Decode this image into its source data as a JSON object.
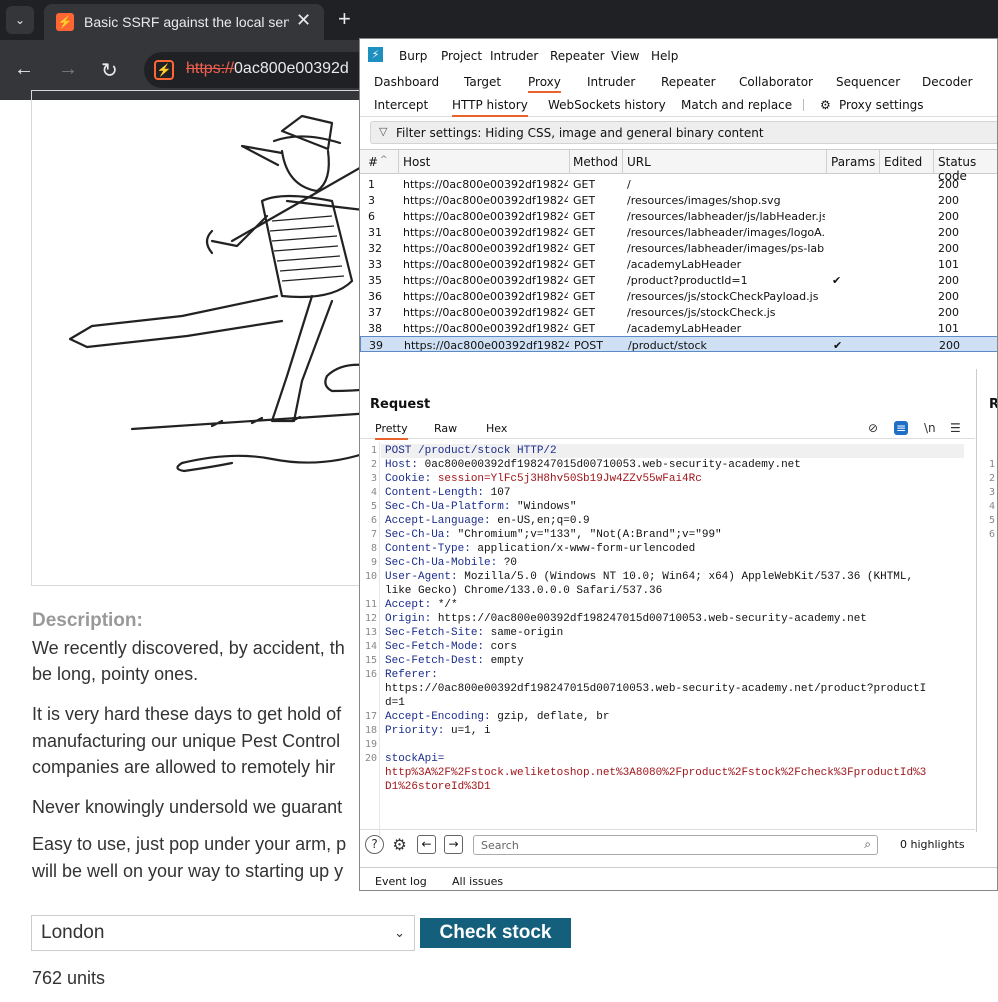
{
  "browser": {
    "tab_title": "Basic SSRF against the local server",
    "url_scheme": "https://",
    "url_rest": "0ac800e00392d"
  },
  "page": {
    "description_label": "Description:",
    "description_lines": [
      "We recently discovered, by accident, th",
      "be long, pointy ones.",
      "It is very hard these days to get hold of",
      "manufacturing our unique Pest Control",
      "companies are allowed to remotely hir",
      "Never knowingly undersold we guarant",
      "Easy to use, just pop under your arm, p",
      "will be well on your way to starting up y"
    ],
    "store_selected": "London",
    "check_stock_label": "Check stock",
    "stock_result": "762 units"
  },
  "burp": {
    "menu": [
      "Burp",
      "Project",
      "Intruder",
      "Repeater",
      "View",
      "Help"
    ],
    "tabs": [
      "Dashboard",
      "Target",
      "Proxy",
      "Intruder",
      "Repeater",
      "Collaborator",
      "Sequencer",
      "Decoder"
    ],
    "active_tab": "Proxy",
    "subtabs": [
      "Intercept",
      "HTTP history",
      "WebSockets history",
      "Match and replace"
    ],
    "proxy_settings": "Proxy settings",
    "filter_text": "Filter settings: Hiding CSS, image and general binary content",
    "columns": [
      "#",
      "Host",
      "Method",
      "URL",
      "Params",
      "Edited",
      "Status code"
    ],
    "rows": [
      {
        "n": "1",
        "host": "https://0ac800e00392df19824...",
        "method": "GET",
        "url": "/",
        "params": "",
        "status": "200"
      },
      {
        "n": "3",
        "host": "https://0ac800e00392df19824...",
        "method": "GET",
        "url": "/resources/images/shop.svg",
        "params": "",
        "status": "200"
      },
      {
        "n": "6",
        "host": "https://0ac800e00392df19824...",
        "method": "GET",
        "url": "/resources/labheader/js/labHeader.js",
        "params": "",
        "status": "200"
      },
      {
        "n": "31",
        "host": "https://0ac800e00392df19824...",
        "method": "GET",
        "url": "/resources/labheader/images/logoA...",
        "params": "",
        "status": "200"
      },
      {
        "n": "32",
        "host": "https://0ac800e00392df19824...",
        "method": "GET",
        "url": "/resources/labheader/images/ps-lab...",
        "params": "",
        "status": "200"
      },
      {
        "n": "33",
        "host": "https://0ac800e00392df19824...",
        "method": "GET",
        "url": "/academyLabHeader",
        "params": "",
        "status": "101"
      },
      {
        "n": "35",
        "host": "https://0ac800e00392df19824...",
        "method": "GET",
        "url": "/product?productId=1",
        "params": "✔",
        "status": "200"
      },
      {
        "n": "36",
        "host": "https://0ac800e00392df19824...",
        "method": "GET",
        "url": "/resources/js/stockCheckPayload.js",
        "params": "",
        "status": "200"
      },
      {
        "n": "37",
        "host": "https://0ac800e00392df19824...",
        "method": "GET",
        "url": "/resources/js/stockCheck.js",
        "params": "",
        "status": "200"
      },
      {
        "n": "38",
        "host": "https://0ac800e00392df19824...",
        "method": "GET",
        "url": "/academyLabHeader",
        "params": "",
        "status": "101"
      },
      {
        "n": "39",
        "host": "https://0ac800e00392df19824...",
        "method": "POST",
        "url": "/product/stock",
        "params": "✔",
        "status": "200"
      }
    ],
    "request": {
      "title": "Request",
      "tabs": [
        "Pretty",
        "Raw",
        "Hex"
      ],
      "newline_label": "\\n",
      "lines": [
        {
          "k": "POST /product/stock HTTP/2",
          "v": ""
        },
        {
          "k": "Host:",
          "v": " 0ac800e00392df198247015d00710053.web-security-academy.net"
        },
        {
          "k": "Cookie:",
          "v": " session=YlFc5j3H8hv50Sb19Jw4ZZv55wFai4Rc"
        },
        {
          "k": "Content-Length:",
          "v": " 107"
        },
        {
          "k": "Sec-Ch-Ua-Platform:",
          "v": " \"Windows\""
        },
        {
          "k": "Accept-Language:",
          "v": " en-US,en;q=0.9"
        },
        {
          "k": "Sec-Ch-Ua:",
          "v": " \"Chromium\";v=\"133\", \"Not(A:Brand\";v=\"99\""
        },
        {
          "k": "Content-Type:",
          "v": " application/x-www-form-urlencoded"
        },
        {
          "k": "Sec-Ch-Ua-Mobile:",
          "v": " ?0"
        },
        {
          "k": "User-Agent:",
          "v": " Mozilla/5.0 (Windows NT 10.0; Win64; x64) AppleWebKit/537.36 (KHTML,"
        },
        {
          "k": "",
          "v": "like Gecko) Chrome/133.0.0.0 Safari/537.36"
        },
        {
          "k": "Accept:",
          "v": " */*"
        },
        {
          "k": "Origin:",
          "v": " https://0ac800e00392df198247015d00710053.web-security-academy.net"
        },
        {
          "k": "Sec-Fetch-Site:",
          "v": " same-origin"
        },
        {
          "k": "Sec-Fetch-Mode:",
          "v": " cors"
        },
        {
          "k": "Sec-Fetch-Dest:",
          "v": " empty"
        },
        {
          "k": "Referer:",
          "v": ""
        },
        {
          "k": "",
          "v": "https://0ac800e00392df198247015d00710053.web-security-academy.net/product?productI"
        },
        {
          "k": "",
          "v": "d=1"
        },
        {
          "k": "Accept-Encoding:",
          "v": " gzip, deflate, br"
        },
        {
          "k": "Priority:",
          "v": " u=1, i"
        },
        {
          "k": "",
          "v": ""
        },
        {
          "k": "stockApi=",
          "v": ""
        },
        {
          "k": "",
          "r": "http%3A%2F%2Fstock.weliketoshop.net%3A8080%2Fproduct%2Fstock%2Fcheck%3FproductId%3"
        },
        {
          "k": "",
          "r": "D1%26storeId%3D1"
        }
      ],
      "line_numbers": [
        "1",
        "2",
        "3",
        "4",
        "5",
        "6",
        "7",
        "8",
        "9",
        "10",
        "",
        "11",
        "12",
        "13",
        "14",
        "15",
        "16",
        "",
        "",
        "17",
        "18",
        "19",
        "20",
        "",
        ""
      ],
      "search_placeholder": "Search",
      "highlights": "0 highlights"
    },
    "response": {
      "title": "Re",
      "line_numbers": [
        "1",
        "2",
        "3",
        "4",
        "5",
        "6"
      ]
    },
    "status_bar": [
      "Event log",
      "All issues"
    ]
  }
}
